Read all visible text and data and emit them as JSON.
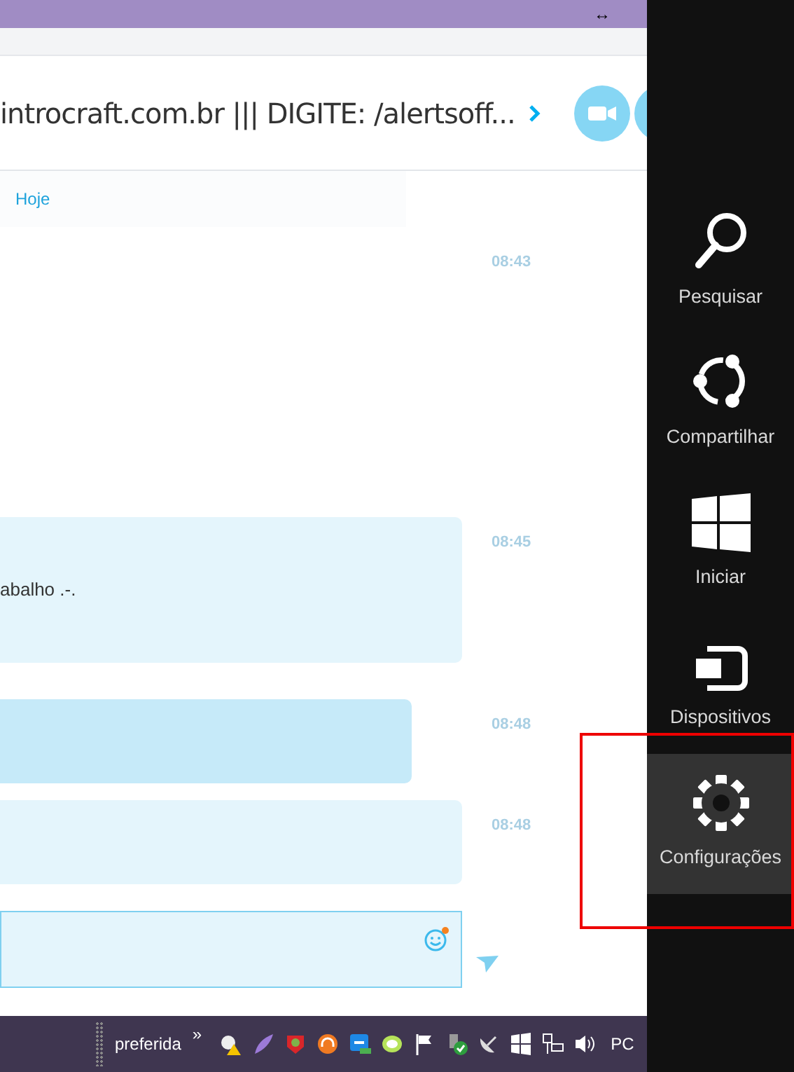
{
  "top_bar": {
    "resize_glyph": "↔"
  },
  "header": {
    "title": "introcraft.com.br ||| DIGITE: /alertsoff..."
  },
  "date_label": "Hoje",
  "messages": [
    {
      "kind": "plain",
      "time": "08:43"
    },
    {
      "kind": "received",
      "time": "08:45",
      "text": "abalho .-."
    },
    {
      "kind": "sent",
      "time": "08:48"
    },
    {
      "kind": "received",
      "time": "08:48"
    }
  ],
  "taskbar": {
    "toolbar_label": "preferida",
    "overflow": "»",
    "clock": "PC"
  },
  "charms": [
    {
      "kind": "search",
      "label": "Pesquisar",
      "selected": false
    },
    {
      "kind": "share",
      "label": "Compartilhar",
      "selected": false
    },
    {
      "kind": "start",
      "label": "Iniciar",
      "selected": false
    },
    {
      "kind": "devices",
      "label": "Dispositivos",
      "selected": false
    },
    {
      "kind": "settings",
      "label": "Configurações",
      "selected": true
    }
  ]
}
